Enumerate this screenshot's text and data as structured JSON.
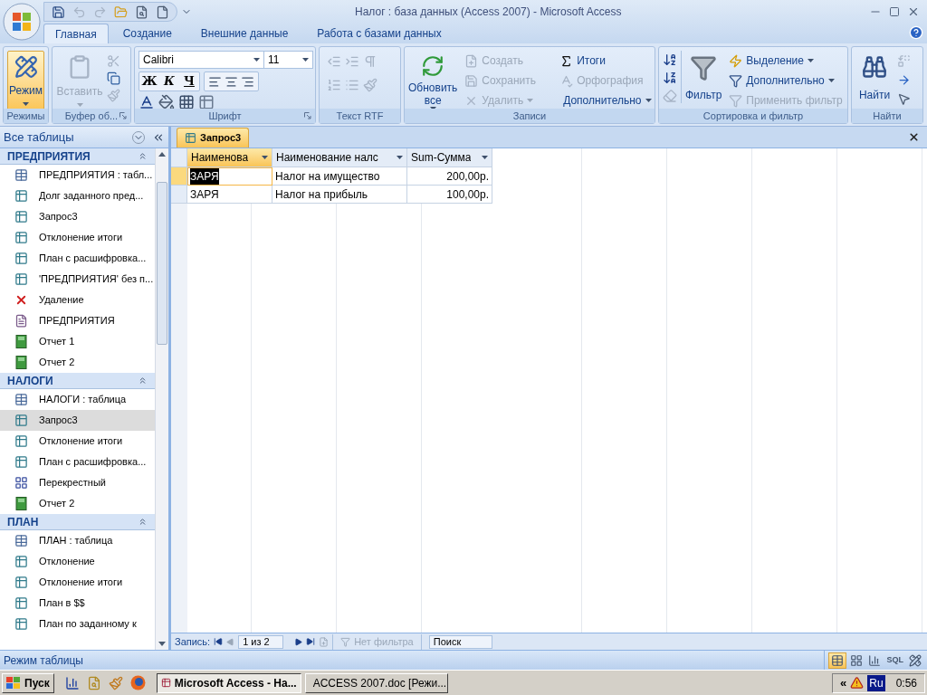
{
  "window": {
    "title": "Налог : база данных (Access 2007) - Microsoft Access"
  },
  "ribbon_tabs": [
    {
      "label": "Главная",
      "selected": true
    },
    {
      "label": "Создание",
      "selected": false
    },
    {
      "label": "Внешние данные",
      "selected": false
    },
    {
      "label": "Работа с базами данных",
      "selected": false
    }
  ],
  "ribbon": {
    "modes": {
      "label": "Режимы",
      "button": {
        "label": "Режим",
        "active": true
      }
    },
    "clipboard": {
      "label": "Буфер об...",
      "paste": {
        "label": "Вставить",
        "disabled": true
      }
    },
    "font": {
      "label": "Шрифт",
      "font_name": "Calibri",
      "font_size": "11",
      "styles": [
        {
          "label": "Ж",
          "kind": "bold"
        },
        {
          "label": "К",
          "kind": "italic"
        },
        {
          "label": "Ч",
          "kind": "underline"
        }
      ]
    },
    "rtf": {
      "label": "Текст RTF"
    },
    "records": {
      "label": "Записи",
      "refresh": {
        "label": "Обновить все"
      },
      "commands": [
        {
          "label": "Создать",
          "kind": "new",
          "disabled": true,
          "dropdown": false
        },
        {
          "label": "Сохранить",
          "kind": "save",
          "disabled": true,
          "dropdown": false
        },
        {
          "label": "Удалить",
          "kind": "delete",
          "disabled": true,
          "dropdown": true
        },
        {
          "label": "Итоги",
          "kind": "totals",
          "disabled": false,
          "dropdown": false
        },
        {
          "label": "Орфография",
          "kind": "spelling",
          "disabled": true,
          "dropdown": false
        },
        {
          "label": "Дополнительно",
          "kind": "more",
          "disabled": false,
          "dropdown": true
        }
      ]
    },
    "sort_filter": {
      "label": "Сортировка и фильтр",
      "filter": {
        "label": "Фильтр"
      },
      "commands": [
        {
          "label": "Выделение",
          "kind": "selection",
          "disabled": false,
          "dropdown": true
        },
        {
          "label": "Дополнительно",
          "kind": "advanced",
          "disabled": false,
          "dropdown": true
        },
        {
          "label": "Применить фильтр",
          "kind": "apply",
          "disabled": true,
          "dropdown": false
        }
      ]
    },
    "find": {
      "label": "Найти",
      "button": {
        "label": "Найти"
      }
    }
  },
  "nav": {
    "title": "Все таблицы",
    "groups": [
      {
        "label": "ПРЕДПРИЯТИЯ",
        "expanded": true,
        "items": [
          {
            "label": "ПРЕДПРИЯТИЯ : табл...",
            "kind": "table",
            "selected": false
          },
          {
            "label": "Долг заданного пред...",
            "kind": "query",
            "selected": false
          },
          {
            "label": "Запрос3",
            "kind": "query",
            "selected": false
          },
          {
            "label": "Отклонение итоги",
            "kind": "query",
            "selected": false
          },
          {
            "label": "План с расшифровка...",
            "kind": "query",
            "selected": false
          },
          {
            "label": "'ПРЕДПРИЯТИЯ' без п...",
            "kind": "query",
            "selected": false
          },
          {
            "label": "Удаление",
            "kind": "delete",
            "selected": false
          },
          {
            "label": "ПРЕДПРИЯТИЯ",
            "kind": "form",
            "selected": false
          },
          {
            "label": "Отчет 1",
            "kind": "report",
            "selected": false
          },
          {
            "label": "Отчет 2",
            "kind": "report",
            "selected": false
          }
        ]
      },
      {
        "label": "НАЛОГИ",
        "expanded": true,
        "items": [
          {
            "label": "НАЛОГИ : таблица",
            "kind": "table",
            "selected": false
          },
          {
            "label": "Запрос3",
            "kind": "query",
            "selected": true
          },
          {
            "label": "Отклонение итоги",
            "kind": "query",
            "selected": false
          },
          {
            "label": "План с расшифровка...",
            "kind": "query",
            "selected": false
          },
          {
            "label": "Перекрестный",
            "kind": "crosstab",
            "selected": false
          },
          {
            "label": "Отчет 2",
            "kind": "report",
            "selected": false
          }
        ]
      },
      {
        "label": "ПЛАН",
        "expanded": true,
        "items": [
          {
            "label": "ПЛАН : таблица",
            "kind": "table",
            "selected": false
          },
          {
            "label": "Отклонение",
            "kind": "query",
            "selected": false
          },
          {
            "label": "Отклонение итоги",
            "kind": "query",
            "selected": false
          },
          {
            "label": "План в $$",
            "kind": "query",
            "selected": false
          },
          {
            "label": "План по заданному к",
            "kind": "query",
            "selected": false
          }
        ]
      }
    ]
  },
  "document": {
    "tabs": [
      {
        "label": "Запрос3",
        "selected": true
      }
    ],
    "columns": [
      {
        "label": "Наименова",
        "selected": true
      },
      {
        "label": "Наименование налс",
        "selected": false
      },
      {
        "label": "Sum-Сумма",
        "selected": false
      }
    ],
    "rows": [
      {
        "selected": true,
        "cells": [
          "ЗАРЯ",
          "Налог на имущество",
          "200,00р."
        ]
      },
      {
        "selected": false,
        "cells": [
          "ЗАРЯ",
          "Налог на прибыль",
          "100,00р."
        ]
      }
    ]
  },
  "record_nav": {
    "label": "Запись:",
    "position": "1 из 2",
    "filter": {
      "label": "Нет фильтра",
      "disabled": true
    },
    "search": {
      "placeholder": "Поиск"
    }
  },
  "status_bar": {
    "text": "Режим таблицы",
    "views": [
      {
        "kind": "datasheet",
        "selected": true
      },
      {
        "kind": "pivot_table",
        "selected": false
      },
      {
        "kind": "pivot_chart",
        "selected": false
      },
      {
        "kind": "sql",
        "label": "SQL",
        "selected": false
      },
      {
        "kind": "design",
        "selected": false
      }
    ]
  },
  "taskbar": {
    "start": "Пуск",
    "tasks": [
      {
        "label": "Microsoft Access - На...",
        "active": true
      },
      {
        "label": "ACCESS 2007.doc [Режи...",
        "active": false
      }
    ],
    "tray": {
      "expand": "«",
      "language": "Ru",
      "time": "0:56"
    }
  }
}
